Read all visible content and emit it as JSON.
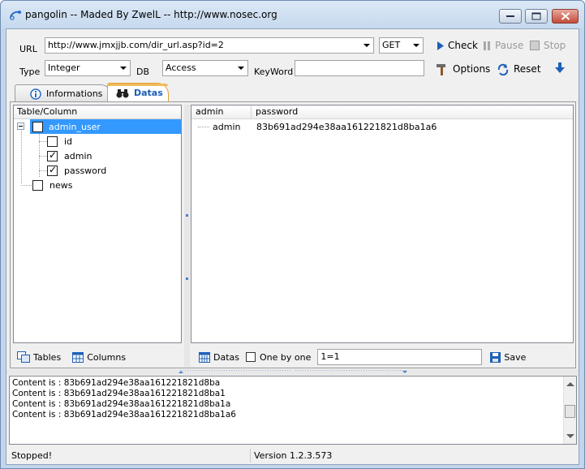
{
  "window": {
    "title": "pangolin -- Maded By ZwelL -- http://www.nosec.org"
  },
  "toolbar": {
    "url_label": "URL",
    "url_value": "http://www.jmxjjb.com/dir_url.asp?id=2",
    "method_value": "GET",
    "type_label": "Type",
    "type_value": "Integer",
    "db_label": "DB",
    "db_value": "Access",
    "keyword_label": "KeyWord",
    "keyword_value": "",
    "check_label": "Check",
    "pause_label": "Pause",
    "stop_label": "Stop",
    "options_label": "Options",
    "reset_label": "Reset"
  },
  "tabs": [
    {
      "label": "Informations",
      "active": false
    },
    {
      "label": "Datas",
      "active": true
    }
  ],
  "tree": {
    "header": "Table/Column",
    "table": {
      "name": "admin_user",
      "checked": false
    },
    "columns": [
      {
        "name": "id",
        "checked": false
      },
      {
        "name": "admin",
        "checked": true
      },
      {
        "name": "password",
        "checked": true
      }
    ],
    "other_table": {
      "name": "news",
      "checked": false
    }
  },
  "grid": {
    "headers": [
      "admin",
      "password"
    ],
    "rows": [
      {
        "admin": "admin",
        "password": "83b691ad294e38aa161221821d8ba1a6"
      }
    ]
  },
  "left_bar": {
    "tables_label": "Tables",
    "columns_label": "Columns"
  },
  "right_bar": {
    "datas_label": "Datas",
    "one_by_one_label": "One by one",
    "one_by_one_checked": false,
    "condition_value": "1=1",
    "save_label": "Save"
  },
  "log": {
    "lines": [
      "Content is : 83b691ad294e38aa161221821d8ba",
      "Content is : 83b691ad294e38aa161221821d8ba1",
      "Content is : 83b691ad294e38aa161221821d8ba1a",
      "Content is : 83b691ad294e38aa161221821d8ba1a6"
    ]
  },
  "status": {
    "state": "Stopped!",
    "version": "Version  1.2.3.573"
  },
  "colors": {
    "selection": "#3399ff",
    "active_tab_accent": "#f2b957",
    "link_blue": "#1c5fb8",
    "close_button": "#c24b39"
  }
}
